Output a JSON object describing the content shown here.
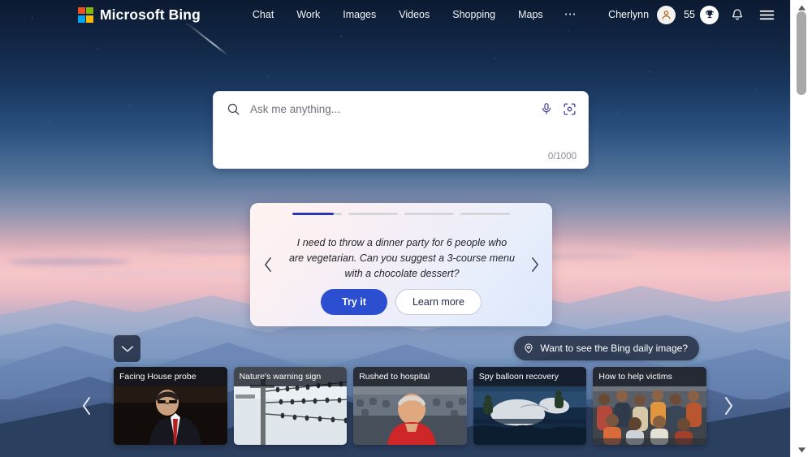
{
  "header": {
    "brand": "Microsoft Bing",
    "logo_icon": "microsoft-logo-icon",
    "nav": [
      {
        "label": "Chat"
      },
      {
        "label": "Work"
      },
      {
        "label": "Images"
      },
      {
        "label": "Videos"
      },
      {
        "label": "Shopping"
      },
      {
        "label": "Maps"
      }
    ],
    "more_label": "⋯",
    "user_name": "Cherlynn",
    "avatar_icon": "user-avatar-icon",
    "rewards_count": "55",
    "rewards_icon": "rewards-trophy-icon",
    "notifications_icon": "bell-icon",
    "menu_icon": "hamburger-menu-icon"
  },
  "search": {
    "magnifier_icon": "search-icon",
    "placeholder": "Ask me anything...",
    "value": "",
    "mic_icon": "microphone-icon",
    "visual_search_icon": "visual-search-camera-icon",
    "char_counter": "0/1000"
  },
  "suggestion": {
    "prev_icon": "chevron-left-icon",
    "next_icon": "chevron-right-icon",
    "text": "I need to throw a dinner party for 6 people who are vegetarian. Can you suggest a 3-course menu with a chocolate dessert?",
    "try_label": "Try it",
    "learn_label": "Learn more",
    "progress": [
      {
        "fill_percent": 84
      },
      {
        "fill_percent": 0
      },
      {
        "fill_percent": 0
      },
      {
        "fill_percent": 0
      }
    ],
    "accent_color": "#2b35b8",
    "try_button_color": "#2b4fd0"
  },
  "daily_image": {
    "pin_icon": "location-pin-icon",
    "label": "Want to see the Bing daily image?"
  },
  "collapse": {
    "icon": "chevron-down-icon"
  },
  "news": {
    "prev_icon": "chevron-left-icon",
    "next_icon": "chevron-right-icon",
    "cards": [
      {
        "title": "Facing House probe"
      },
      {
        "title": "Nature's warning sign"
      },
      {
        "title": "Rushed to hospital"
      },
      {
        "title": "Spy balloon recovery"
      },
      {
        "title": "How to help victims"
      }
    ]
  },
  "scrollbar": {
    "up_icon": "scroll-up-arrow-icon",
    "down_icon": "scroll-down-arrow-icon"
  }
}
